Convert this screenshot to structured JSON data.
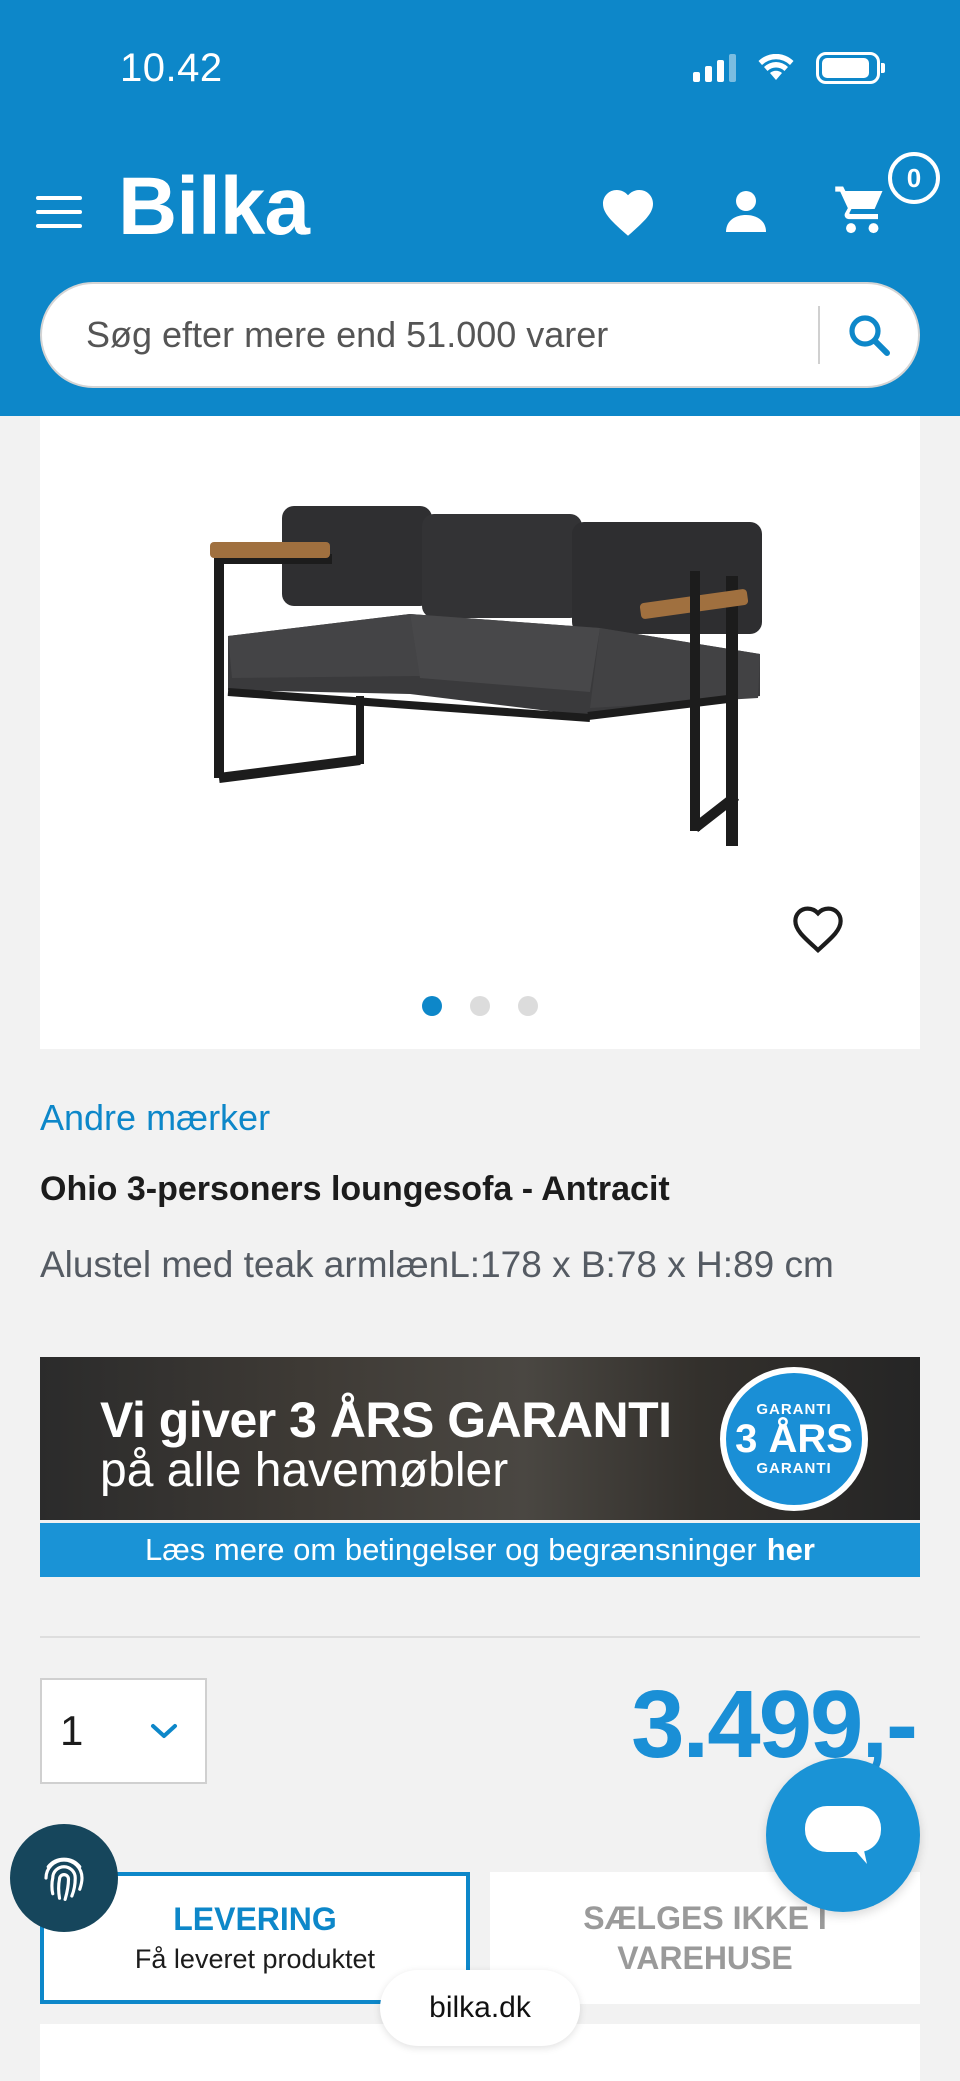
{
  "status_bar": {
    "time": "10.42"
  },
  "header": {
    "logo": "Bilka",
    "cart_count": "0",
    "search_placeholder": "Søg efter mere end 51.000 varer"
  },
  "gallery": {
    "total_images": 3,
    "active_index": 0
  },
  "product": {
    "brand": "Andre mærker",
    "title": "Ohio 3-personers loungesofa - Antracit",
    "subtitle": "Alustel med teak armlænL:178 x B:78 x H:89 cm",
    "price": "3.499,-"
  },
  "banner": {
    "line1": "Vi giver 3 ÅRS GARANTI",
    "line2": "på alle havemøbler",
    "seal_top": "GARANTI",
    "seal_main": "3 ÅRS",
    "seal_bottom": "GARANTI",
    "footer_text": "Læs mere om betingelser og begrænsninger",
    "footer_link": "her"
  },
  "quantity": {
    "value": "1"
  },
  "delivery_tabs": [
    {
      "title": "LEVERING",
      "subtitle": "Få leveret produktet",
      "active": true
    },
    {
      "title": "SÆLGES IKKE I VAREHUSE",
      "active": false
    }
  ],
  "browser": {
    "url": "bilka.dk"
  },
  "colors": {
    "brand_blue": "#0d87c9",
    "price_blue": "#1a8fd6",
    "fingerprint_bg": "#16465c"
  },
  "icons": [
    "menu-icon",
    "heart-icon",
    "user-icon",
    "cart-icon",
    "search-icon",
    "favorite-icon",
    "chevron-down-icon",
    "chat-icon",
    "fingerprint-icon"
  ]
}
